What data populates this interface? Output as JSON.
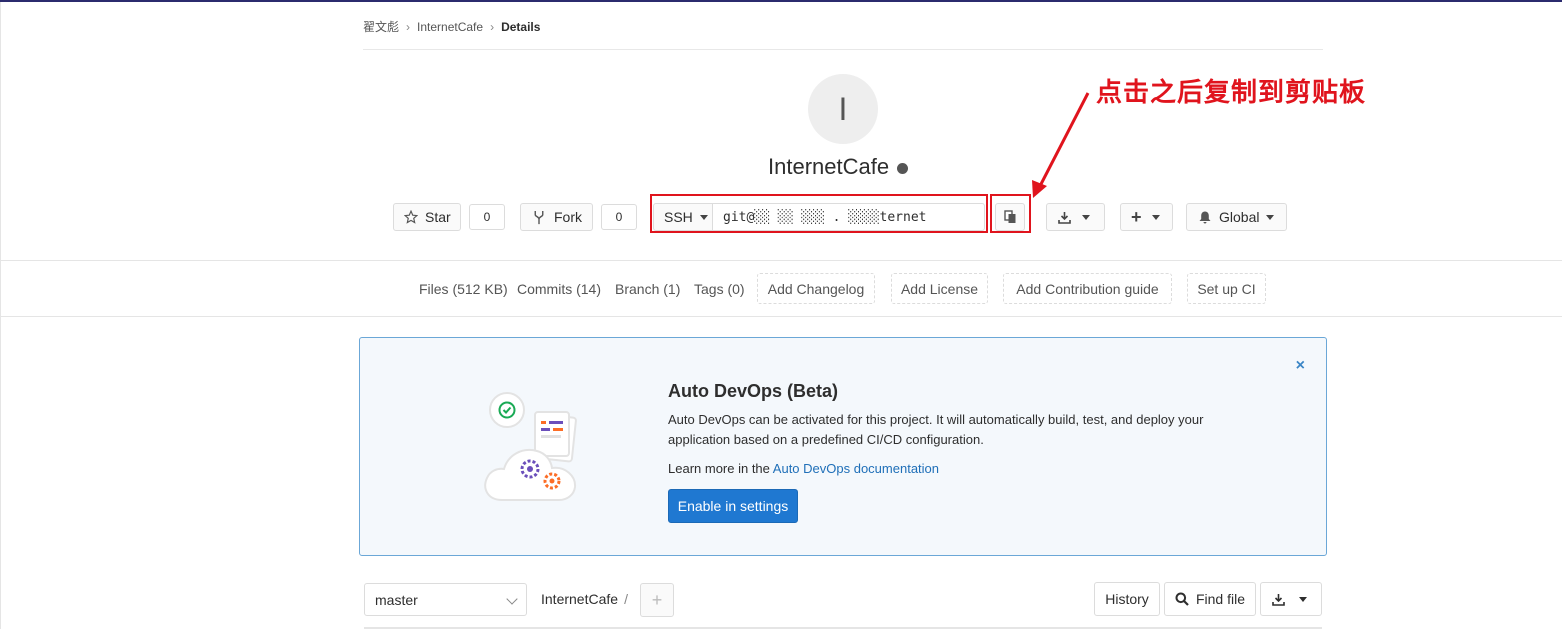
{
  "breadcrumb": {
    "owner": "翟文彪",
    "project": "InternetCafe",
    "current": "Details"
  },
  "project": {
    "avatar_letter": "I",
    "name": "InternetCafe"
  },
  "actions": {
    "star_label": "Star",
    "star_count": "0",
    "fork_label": "Fork",
    "fork_count": "0",
    "protocol": "SSH",
    "clone_url": "git@░░ ░░ ░░░ . ░░░░ternet",
    "notification_label": "Global"
  },
  "annotation": {
    "text": "点击之后复制到剪贴板",
    "color": "#e0141d"
  },
  "nav": {
    "files": "Files (512 KB)",
    "commits": "Commits (14)",
    "branch": "Branch (1)",
    "tags": "Tags (0)",
    "add_changelog": "Add Changelog",
    "add_license": "Add License",
    "add_contribution": "Add Contribution guide",
    "setup_ci": "Set up CI"
  },
  "devops": {
    "title": "Auto DevOps (Beta)",
    "description": "Auto DevOps can be activated for this project. It will automatically build, test, and deploy your application based on a predefined CI/CD configuration.",
    "learn_prefix": "Learn more in the ",
    "learn_link": "Auto DevOps documentation",
    "button_label": "Enable in settings",
    "close_label": "×"
  },
  "tree": {
    "branch": "master",
    "path": "InternetCafe",
    "path_separator": "/",
    "history_label": "History",
    "find_file_label": "Find file"
  },
  "colors": {
    "accent": "#1f78d1",
    "link": "#1f6fb8",
    "annotation": "#e0141d"
  }
}
